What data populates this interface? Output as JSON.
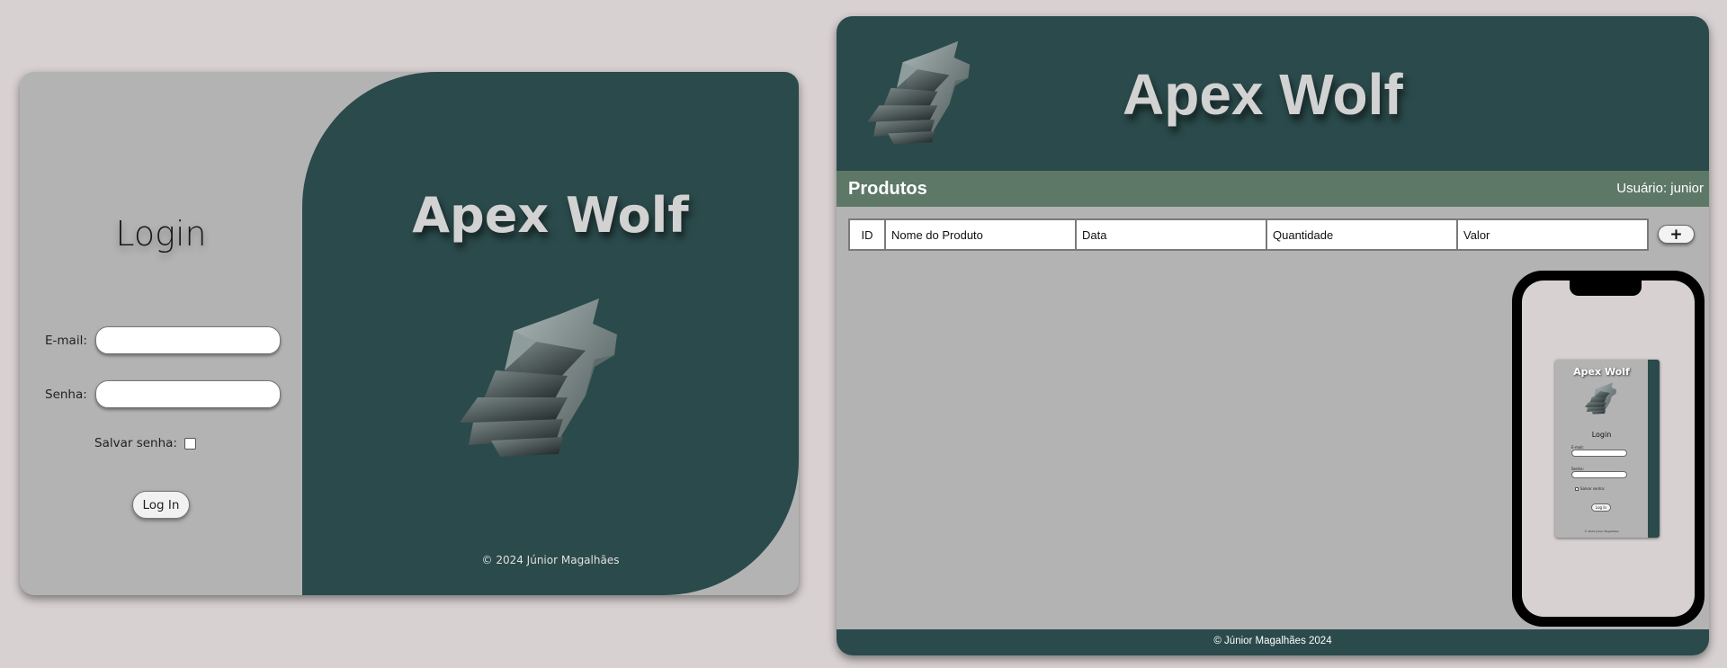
{
  "login": {
    "title": "Login",
    "email_label": "E-mail:",
    "email_value": "",
    "password_label": "Senha:",
    "password_value": "",
    "save_password_label": "Salvar senha:",
    "save_password_checked": false,
    "submit_label": "Log In",
    "brand": "Apex Wolf",
    "copyright": "© 2024 Júnior Magalhães"
  },
  "dashboard": {
    "brand": "Apex Wolf",
    "section_title": "Produtos",
    "user_label": "Usuário: junior",
    "table": {
      "columns": [
        "ID",
        "Nome do Produto",
        "Data",
        "Quantidade",
        "Valor"
      ],
      "rows": []
    },
    "add_button_label": "+",
    "footer": "© Júnior Magalhães 2024"
  },
  "mobile_preview": {
    "brand": "Apex Wolf",
    "title": "Login",
    "email_label": "E-mail:",
    "password_label": "Senha:",
    "save_password_label": "Salvar senha:",
    "submit_label": "Log In",
    "copyright": "© 2024 Júnior Magalhães"
  },
  "colors": {
    "background": "#d8d1d1",
    "panel_gray": "#b3b3b3",
    "brand_teal": "#2b4a4b",
    "section_green": "#5e7868",
    "brand_text": "#d2d2d2"
  },
  "icons": {
    "logo": "wolf-head-logo-icon",
    "add": "plus-icon"
  }
}
